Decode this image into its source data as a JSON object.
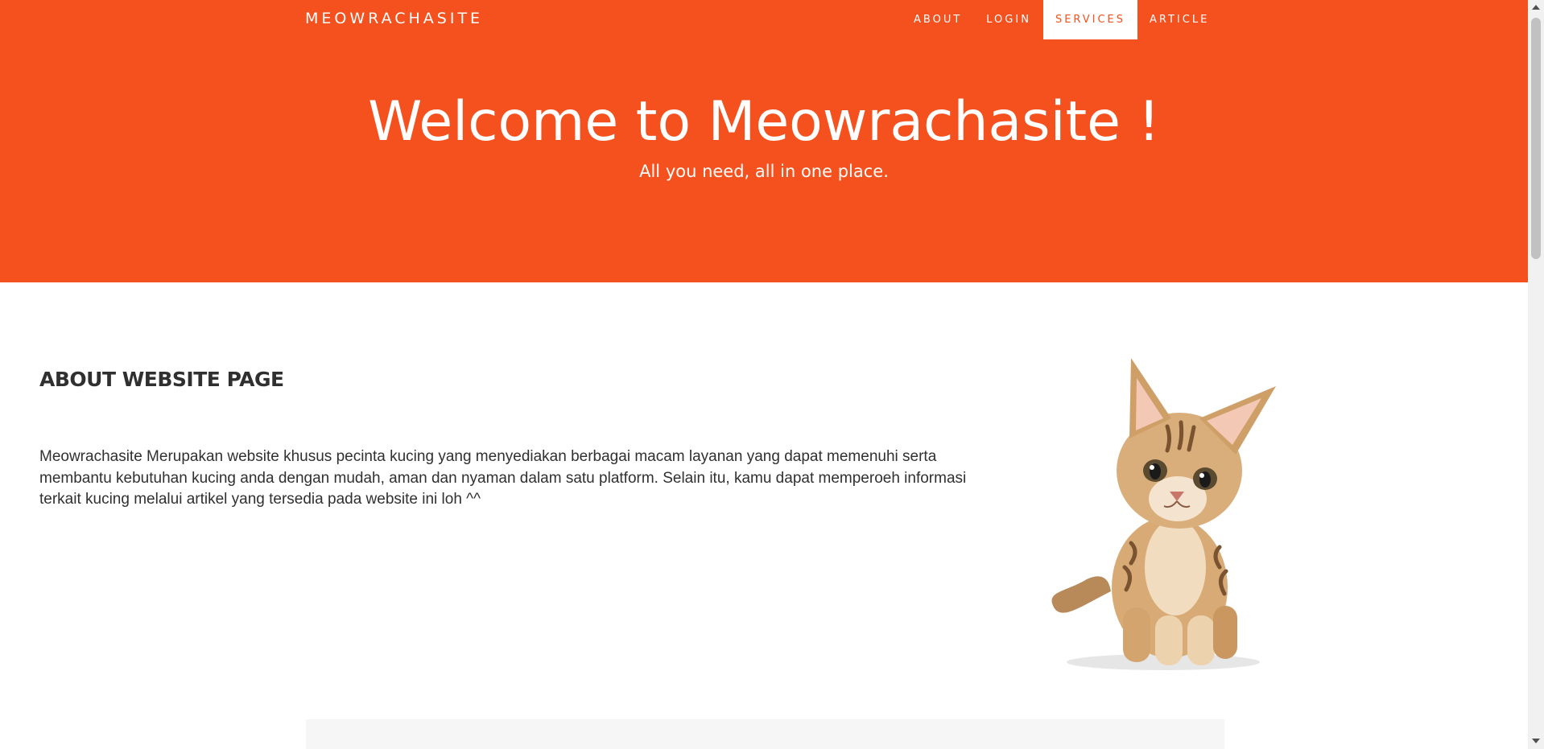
{
  "navbar": {
    "brand": "MEOWRACHASITE",
    "items": [
      {
        "label": "ABOUT"
      },
      {
        "label": "LOGIN"
      },
      {
        "label": "SERVICES",
        "active": true
      },
      {
        "label": "ARTICLE"
      }
    ]
  },
  "hero": {
    "title": "Welcome to Meowrachasite !",
    "subtitle": "All you need, all in one place."
  },
  "about": {
    "heading": "ABOUT WEBSITE PAGE",
    "body": "Meowrachasite Merupakan website khusus pecinta kucing yang menyediakan berbagai macam layanan yang dapat memenuhi serta membantu kebutuhan kucing anda dengan mudah, aman dan nyaman dalam satu platform. Selain itu, kamu dapat memperoeh informasi terkait kucing melalui artikel yang tersedia pada website ini loh ^^",
    "image_icon": "kitten-image"
  },
  "colors": {
    "primary": "#f4511e",
    "text": "#303030",
    "panel": "#f6f6f6"
  }
}
